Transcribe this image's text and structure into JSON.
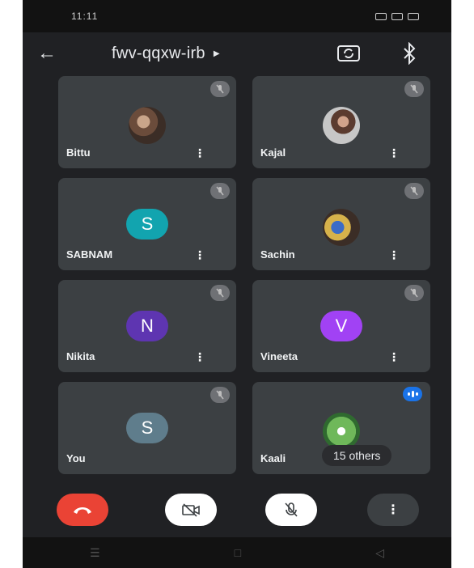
{
  "status_bar": {
    "time": "11:11"
  },
  "header": {
    "meeting_code": "fwv-qqxw-irb"
  },
  "participants": [
    {
      "name": "Bittu"
    },
    {
      "name": "Kajal"
    },
    {
      "name": "SABNAM",
      "initial": "S",
      "color": "#12a4af"
    },
    {
      "name": "Sachin"
    },
    {
      "name": "Nikita",
      "initial": "N",
      "color": "#5e35b1"
    },
    {
      "name": "Vineeta",
      "initial": "V",
      "color": "#a142f4"
    },
    {
      "name": "You",
      "initial": "S",
      "color": "#5f7d8c"
    },
    {
      "name": "Kaali",
      "others_label": "15 others"
    }
  ],
  "colors": {
    "background": "#202124",
    "tile": "#3c4043",
    "end_call": "#ea4335",
    "speaking": "#1a73e8"
  },
  "icons": [
    "back-arrow-icon",
    "switch-camera-icon",
    "bluetooth-icon",
    "mic-off-icon",
    "more-vert-icon",
    "end-call-icon",
    "camera-off-icon"
  ]
}
